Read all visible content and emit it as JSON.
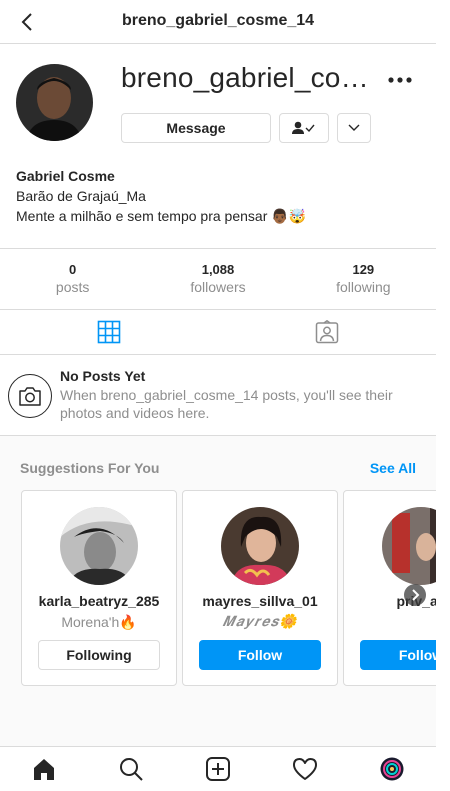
{
  "header": {
    "title": "breno_gabriel_cosme_14",
    "back_icon": "chevron-left-icon"
  },
  "profile": {
    "username_display": "breno_gabriel_co…",
    "message_label": "Message",
    "bio": {
      "name": "Gabriel Cosme",
      "lines": [
        "Barão de Grajaú_Ma",
        "Mente a milhão e sem tempo pra pensar 👨🏾🤯"
      ]
    }
  },
  "stats": [
    {
      "value": "0",
      "label": "posts"
    },
    {
      "value": "1,088",
      "label": "followers"
    },
    {
      "value": "129",
      "label": "following"
    }
  ],
  "tabs": [
    "grid-icon",
    "tagged-icon"
  ],
  "no_posts": {
    "title": "No Posts Yet",
    "text": "When breno_gabriel_cosme_14 posts, you'll see their photos and videos here."
  },
  "suggestions": {
    "title": "Suggestions For You",
    "see_all": "See All",
    "cards": [
      {
        "username": "karla_beatryz_285",
        "subtitle": "Morena'h🔥",
        "button": "Following"
      },
      {
        "username": "mayres_sillva_01",
        "subtitle": "𝑴𝒂𝒚𝒓𝒆𝒔🌼",
        "button": "Follow"
      },
      {
        "username": "priv_all",
        "subtitle": "",
        "button": "Follow"
      }
    ]
  },
  "bottom_nav": [
    "home-icon",
    "search-icon",
    "new-post-icon",
    "activity-heart-icon",
    "profile-avatar-icon"
  ],
  "colors": {
    "accent": "#0095f6",
    "text": "#262626",
    "muted": "#8e8e8e",
    "border": "#dbdbdb"
  }
}
